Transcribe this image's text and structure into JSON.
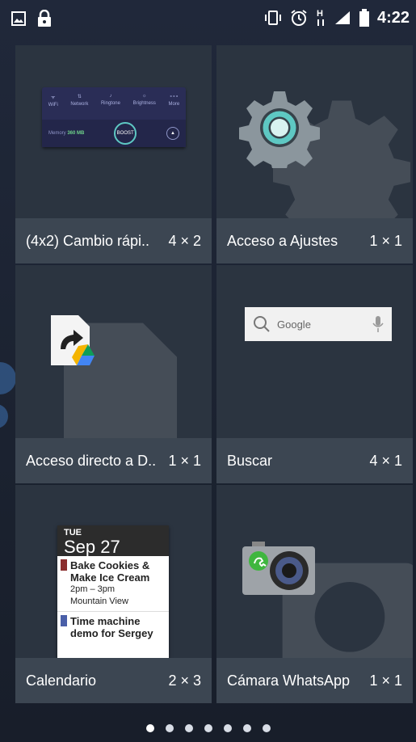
{
  "status_bar": {
    "time": "4:22",
    "left_icons": [
      "image-notification-icon",
      "lock-icon"
    ],
    "right_icons": [
      "vibrate-icon",
      "alarm-icon",
      "hplus-data-icon",
      "signal-icon",
      "battery-icon"
    ]
  },
  "widgets": [
    {
      "name": "(4x2) Cambio rápi..",
      "size": "4 × 2",
      "preview": "quick-toggle-widget"
    },
    {
      "name": "Acceso a Ajustes",
      "size": "1 × 1",
      "preview": "settings-gear-icon"
    },
    {
      "name": "Acceso directo a D..",
      "size": "1 × 1",
      "preview": "drive-shortcut-icon"
    },
    {
      "name": "Buscar",
      "size": "4 × 1",
      "preview": "google-search-bar"
    },
    {
      "name": "Calendario",
      "size": "2 × 3",
      "preview": "calendar-widget"
    },
    {
      "name": "Cámara WhatsApp",
      "size": "1 × 1",
      "preview": "whatsapp-camera-icon"
    }
  ],
  "quick_toggle": {
    "toggles": [
      "WiFi",
      "Network",
      "Ringtone",
      "Brightness",
      "More"
    ],
    "memory_label": "Memory",
    "memory_value": "360 MB",
    "boost_label": "BOOST"
  },
  "search_widget": {
    "placeholder": "Google"
  },
  "calendar_widget": {
    "day_of_week": "TUE",
    "date": "Sep 27",
    "events": [
      {
        "title": "Bake Cookies & Make Ice Cream",
        "time": "2pm – 3pm",
        "location": "Mountain View",
        "color": "#8b2e2e"
      },
      {
        "title": "Time machine demo for Sergey",
        "time": "",
        "location": "",
        "color": "#4a5fa8"
      }
    ]
  },
  "page_indicator": {
    "count": 7,
    "active_index": 0
  },
  "colors": {
    "cell_bg": "#2b3440",
    "label_bar": "#3c4652",
    "settings_accent": "#5ec8c3"
  }
}
